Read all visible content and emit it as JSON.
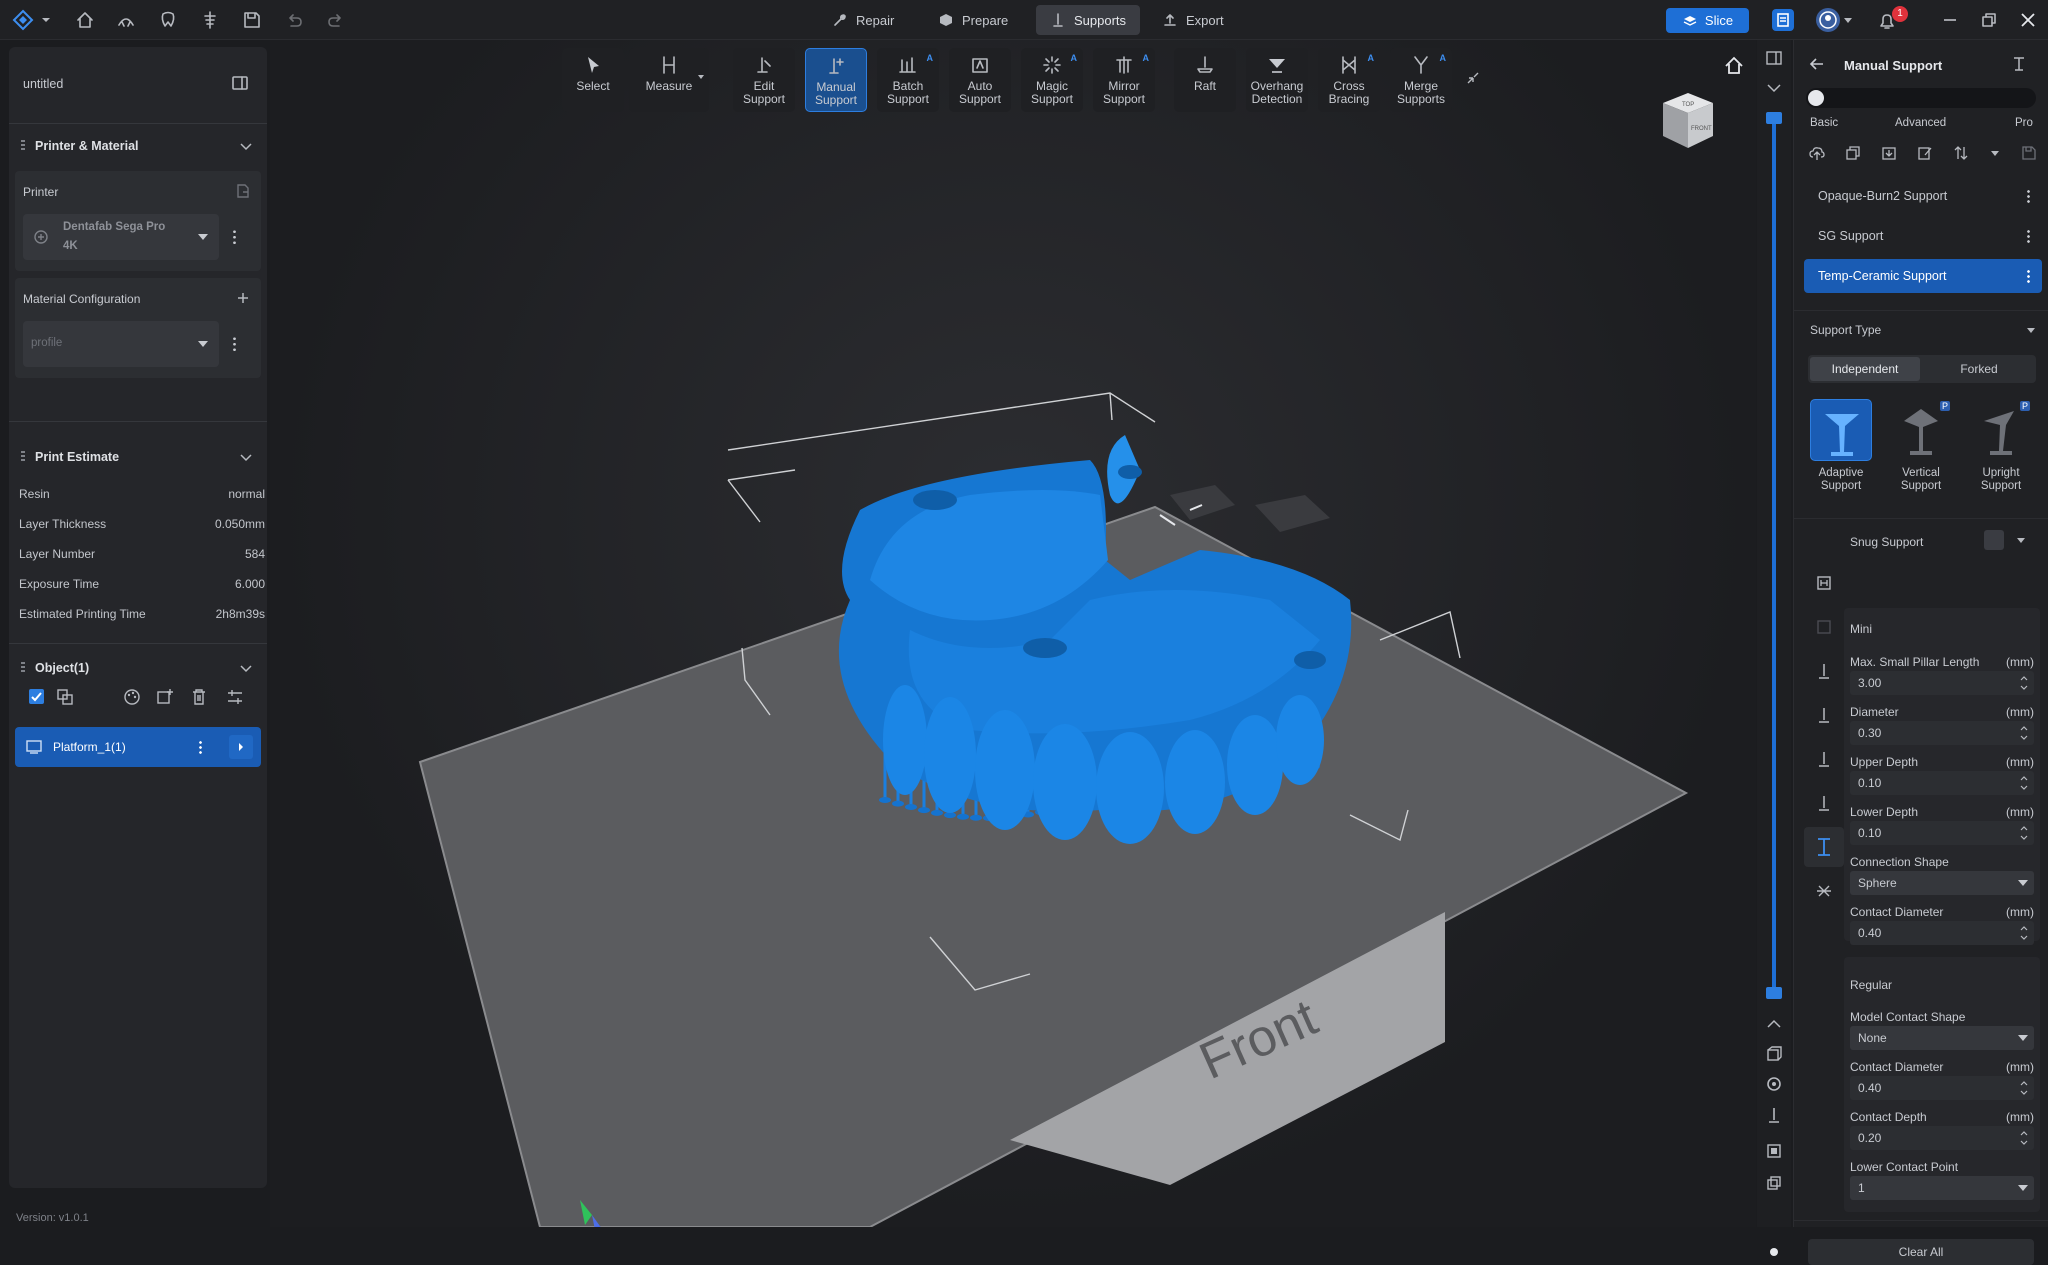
{
  "titlebar": {
    "nav_tabs": [
      {
        "label": "Repair"
      },
      {
        "label": "Prepare"
      },
      {
        "label": "Supports"
      },
      {
        "label": "Export"
      }
    ],
    "slice_label": "Slice",
    "notification_count": "1"
  },
  "left": {
    "project_name": "untitled",
    "printer_material": {
      "title": "Printer & Material",
      "printer_label": "Printer",
      "printer_name_line1": "Dentafab Sega Pro",
      "printer_name_line2": "4K",
      "material_label": "Material Configuration",
      "material_placeholder": "profile"
    },
    "print_estimate": {
      "title": "Print Estimate",
      "rows": [
        {
          "label": "Resin",
          "value": "normal"
        },
        {
          "label": "Layer Thickness",
          "value": "0.050mm"
        },
        {
          "label": "Layer Number",
          "value": "584"
        },
        {
          "label": "Exposure Time",
          "value": "6.000"
        },
        {
          "label": "Estimated Printing Time",
          "value": "2h8m39s"
        }
      ]
    },
    "objects": {
      "title": "Object(1)",
      "platform_label": "Platform_1(1)"
    },
    "version": "Version: v1.0.1"
  },
  "toolbar": {
    "tools": [
      {
        "label1": "Select",
        "label2": ""
      },
      {
        "label1": "Measure",
        "label2": ""
      },
      {
        "label1": "Edit",
        "label2": "Support"
      },
      {
        "label1": "Manual",
        "label2": "Support"
      },
      {
        "label1": "Batch",
        "label2": "Support"
      },
      {
        "label1": "Auto",
        "label2": "Support"
      },
      {
        "label1": "Magic",
        "label2": "Support"
      },
      {
        "label1": "Mirror",
        "label2": "Support"
      },
      {
        "label1": "Raft",
        "label2": ""
      },
      {
        "label1": "Overhang",
        "label2": "Detection"
      },
      {
        "label1": "Cross",
        "label2": "Bracing"
      },
      {
        "label1": "Merge",
        "label2": "Supports"
      }
    ],
    "auto_badge": "A"
  },
  "viewport": {
    "platform_label": "Front",
    "view_cube_top": "TOP",
    "view_cube_front": "FRONT"
  },
  "right": {
    "title": "Manual Support",
    "modes": {
      "basic": "Basic",
      "advanced": "Advanced",
      "pro": "Pro"
    },
    "profiles": [
      {
        "label": "Opaque-Burn2 Support"
      },
      {
        "label": "SG Support"
      },
      {
        "label": "Temp-Ceramic Support"
      }
    ],
    "support_type_label": "Support Type",
    "toggle": {
      "independent": "Independent",
      "forked": "Forked"
    },
    "support_kinds": [
      {
        "line1": "Adaptive",
        "line2": "Support"
      },
      {
        "line1": "Vertical",
        "line2": "Support"
      },
      {
        "line1": "Upright",
        "line2": "Support"
      }
    ],
    "pro_badge": "P",
    "snug_label": "Snug Support",
    "mini_section": "Mini",
    "mini_fields": [
      {
        "label": "Max. Small Pillar Length",
        "unit": "(mm)",
        "value": "3.00"
      },
      {
        "label": "Diameter",
        "unit": "(mm)",
        "value": "0.30"
      },
      {
        "label": "Upper Depth",
        "unit": "(mm)",
        "value": "0.10"
      },
      {
        "label": "Lower Depth",
        "unit": "(mm)",
        "value": "0.10"
      }
    ],
    "connection_shape_label": "Connection Shape",
    "connection_shape_value": "Sphere",
    "contact_diameter_label": "Contact Diameter",
    "contact_diameter_unit": "(mm)",
    "contact_diameter_value": "0.40",
    "regular_section": "Regular",
    "model_contact_shape_label": "Model Contact Shape",
    "model_contact_shape_value": "None",
    "regular_contact_diameter_label": "Contact Diameter",
    "regular_contact_diameter_unit": "(mm)",
    "regular_contact_diameter_value": "0.40",
    "contact_depth_label": "Contact Depth",
    "contact_depth_unit": "(mm)",
    "contact_depth_value": "0.20",
    "lower_contact_point_label": "Lower Contact Point",
    "lower_contact_point_value": "1",
    "clear_all_label": "Clear All"
  },
  "colors": {
    "accent": "#1e6fd6",
    "model": "#1780d8",
    "platform": "#5b5c5f"
  }
}
